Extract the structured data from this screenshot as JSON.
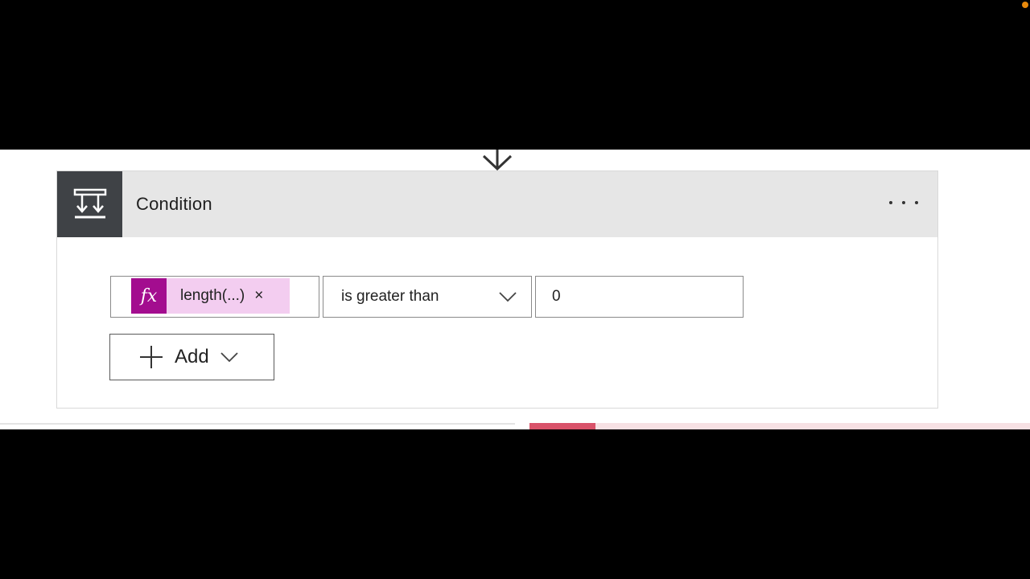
{
  "condition_card": {
    "title": "Condition",
    "icon": "condition-branch-icon",
    "more_icon": "ellipsis-icon"
  },
  "condition": {
    "left_operand": {
      "token_icon_text": "fx",
      "token_label": "length(...)",
      "remove_glyph": "×"
    },
    "operator": {
      "selected": "is greater than",
      "icon": "chevron-down-icon"
    },
    "right_operand": {
      "value": "0"
    }
  },
  "add_button": {
    "label": "Add",
    "plus_icon": "plus-icon",
    "chevron_icon": "chevron-down-icon"
  },
  "colors": {
    "header_bg": "#e6e6e6",
    "header_icon_bg": "#3f4246",
    "token_bg": "#f3cdf0",
    "token_fx_bg": "#a30d8f"
  }
}
